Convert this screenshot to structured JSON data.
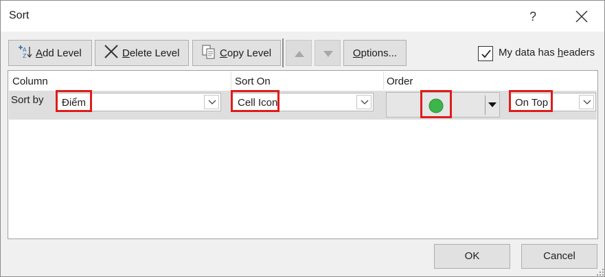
{
  "window": {
    "title": "Sort",
    "help_glyph": "?",
    "close_icon": "close-icon"
  },
  "toolbar": {
    "add_level": {
      "underline": "A",
      "rest": "dd Level"
    },
    "delete_level": {
      "underline": "D",
      "rest": "elete Level"
    },
    "copy_level": {
      "underline": "C",
      "rest": "opy Level"
    },
    "options": {
      "underline": "O",
      "rest": "ptions..."
    },
    "move_up_icon": "triangle-up-icon",
    "move_down_icon": "triangle-down-icon"
  },
  "headers_option": {
    "label_pre": "My data has ",
    "label_underline": "h",
    "label_post": "eaders",
    "checked": true
  },
  "grid": {
    "columns": {
      "column": "Column",
      "sort_on": "Sort On",
      "order": "Order"
    },
    "row": {
      "label": "Sort by",
      "column_value": "Điểm",
      "sort_on_value": "Cell Icon",
      "order_icon_color": "#3cb54a",
      "position_value": "On Top"
    }
  },
  "buttons": {
    "ok": "OK",
    "cancel": "Cancel"
  },
  "colors": {
    "highlight": "#e01b1b",
    "button_bg": "#e1e1e1",
    "row_bg": "#dedede"
  }
}
